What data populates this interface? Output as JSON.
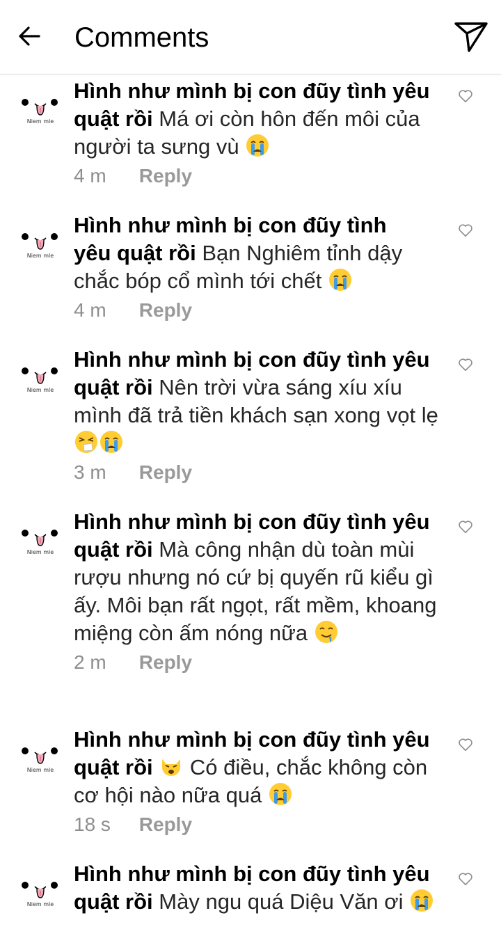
{
  "header": {
    "title": "Comments"
  },
  "icons": {
    "back": "arrow-left-icon",
    "share": "paper-plane-icon",
    "like": "heart-outline-icon",
    "avatar": "cute-tongue-face-avatar"
  },
  "avatar_caption": "Niem mle",
  "colors": {
    "text": "#262626",
    "secondary": "#8e8e8e",
    "divider": "#dbdbdb",
    "emoji_yellow": "#ffcc33",
    "emoji_tear_blue": "#3d9be9"
  },
  "comments": [
    {
      "username": "Hình như mình bị con đũy tình yêu quật rồi",
      "text": "Má ơi còn hôn đến môi của người ta sưng vù",
      "emojis": [
        "crying-face"
      ],
      "time": "4 m",
      "reply": "Reply"
    },
    {
      "username": "Hình như mình bị con đũy tình yêu quật rồi",
      "text": "Bạn Nghiêm tỉnh dậy chắc bóp cổ mình tới chết",
      "emojis": [
        "crying-face"
      ],
      "time": "4 m",
      "reply": "Reply"
    },
    {
      "username": "Hình như mình bị con đũy tình yêu quật rồi",
      "text": "Nên trời vừa sáng xíu xíu mình đã trả tiền khách sạn xong vọt lẹ",
      "emojis": [
        "sneezing-face",
        "crying-face"
      ],
      "time": "3 m",
      "reply": "Reply"
    },
    {
      "username": "Hình như mình bị con đũy tình yêu quật rồi",
      "text": "Mà công nhận dù toàn mùi rượu nhưng nó cứ bị quyến rũ kiểu gì ấy. Môi bạn rất ngọt, rất mềm, khoang miệng còn ấm nóng nữa",
      "emojis": [
        "drooling-face"
      ],
      "time": "2 m",
      "reply": "Reply"
    },
    {
      "username": "Hình như mình bị con đũy tình yêu quật rồi",
      "text": "Có điều, chắc không còn cơ hội nào nữa quá",
      "prefix_emoji": "weary-cat-face",
      "emojis": [
        "crying-face"
      ],
      "time": "18 s",
      "reply": "Reply"
    },
    {
      "username": "Hình như mình bị con đũy tình yêu quật rồi",
      "text": "Mày ngu quá Diệu Văn ơi",
      "emojis": [
        "crying-face"
      ],
      "time": "",
      "reply": ""
    }
  ]
}
